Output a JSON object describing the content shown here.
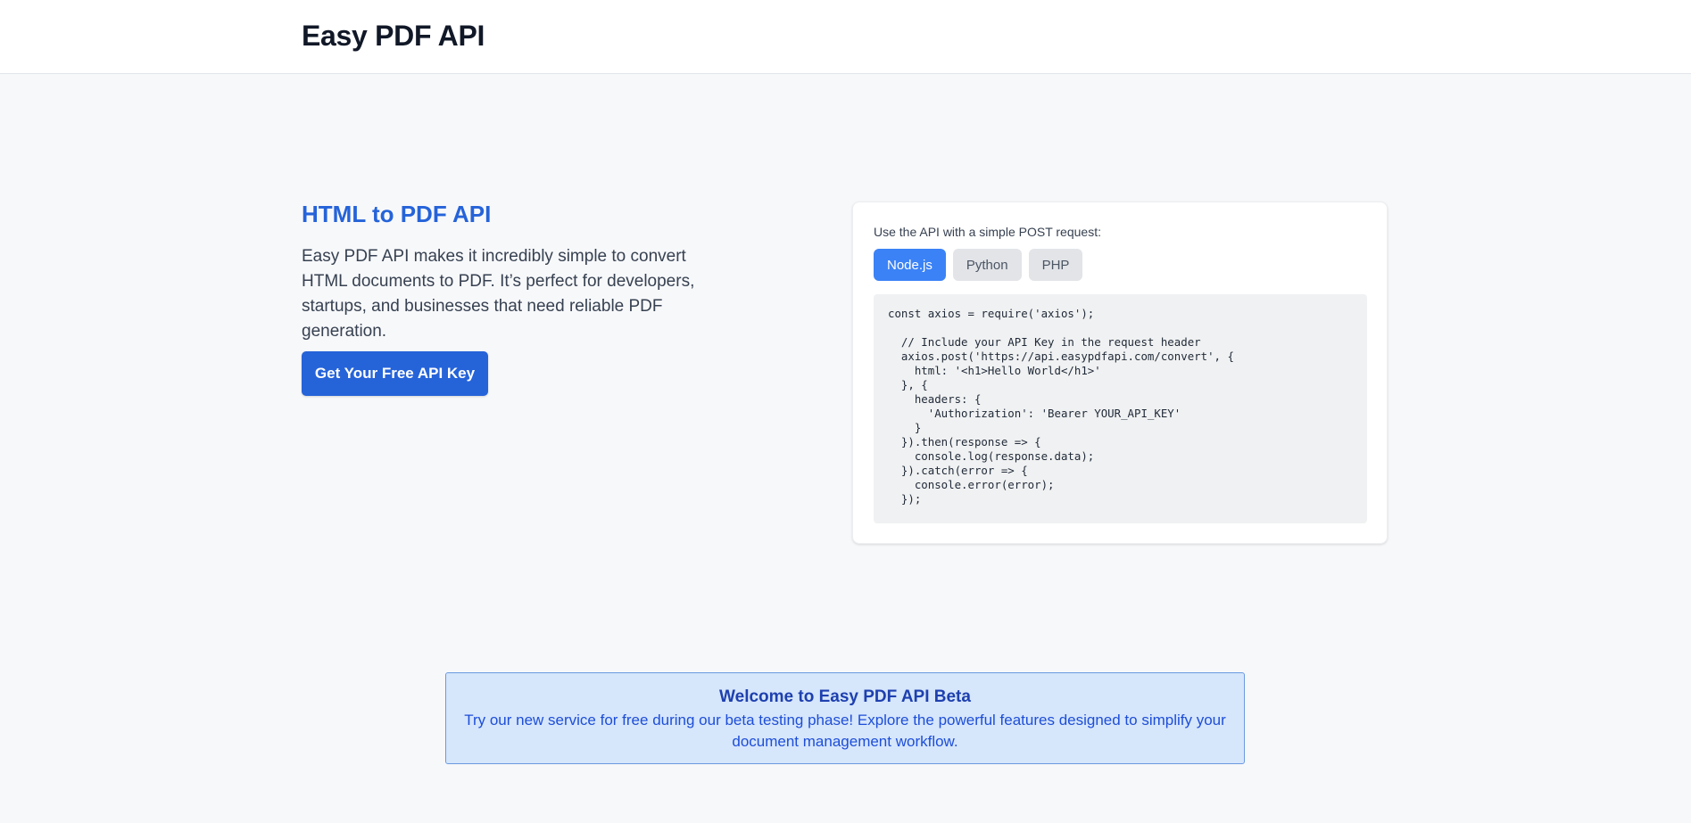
{
  "header": {
    "brand": "Easy PDF API"
  },
  "hero": {
    "title": "HTML to PDF API",
    "description": "Easy PDF API makes it incredibly simple to convert HTML documents to PDF. It’s perfect for developers, startups, and businesses that need reliable PDF generation.",
    "cta_label": "Get Your Free API Key"
  },
  "api_card": {
    "intro": "Use the API with a simple POST request:",
    "tabs": [
      {
        "label": "Node.js",
        "active": true
      },
      {
        "label": "Python",
        "active": false
      },
      {
        "label": "PHP",
        "active": false
      }
    ],
    "code": "const axios = require('axios');\n\n  // Include your API Key in the request header\n  axios.post('https://api.easypdfapi.com/convert', {\n    html: '<h1>Hello World</h1>'\n  }, {\n    headers: {\n      'Authorization': 'Bearer YOUR_API_KEY'\n    }\n  }).then(response => {\n    console.log(response.data);\n  }).catch(error => {\n    console.error(error);\n  });"
  },
  "banner": {
    "title": "Welcome to Easy PDF API Beta",
    "text": "Try our new service for free during our beta testing phase! Explore the powerful features designed to simplify your document management workflow."
  },
  "colors": {
    "accent": "#2563d9",
    "tab_active": "#3b82f6",
    "banner_bg": "#d6e6fb",
    "banner_text": "#1e40af",
    "page_bg": "#f7f8fa"
  }
}
